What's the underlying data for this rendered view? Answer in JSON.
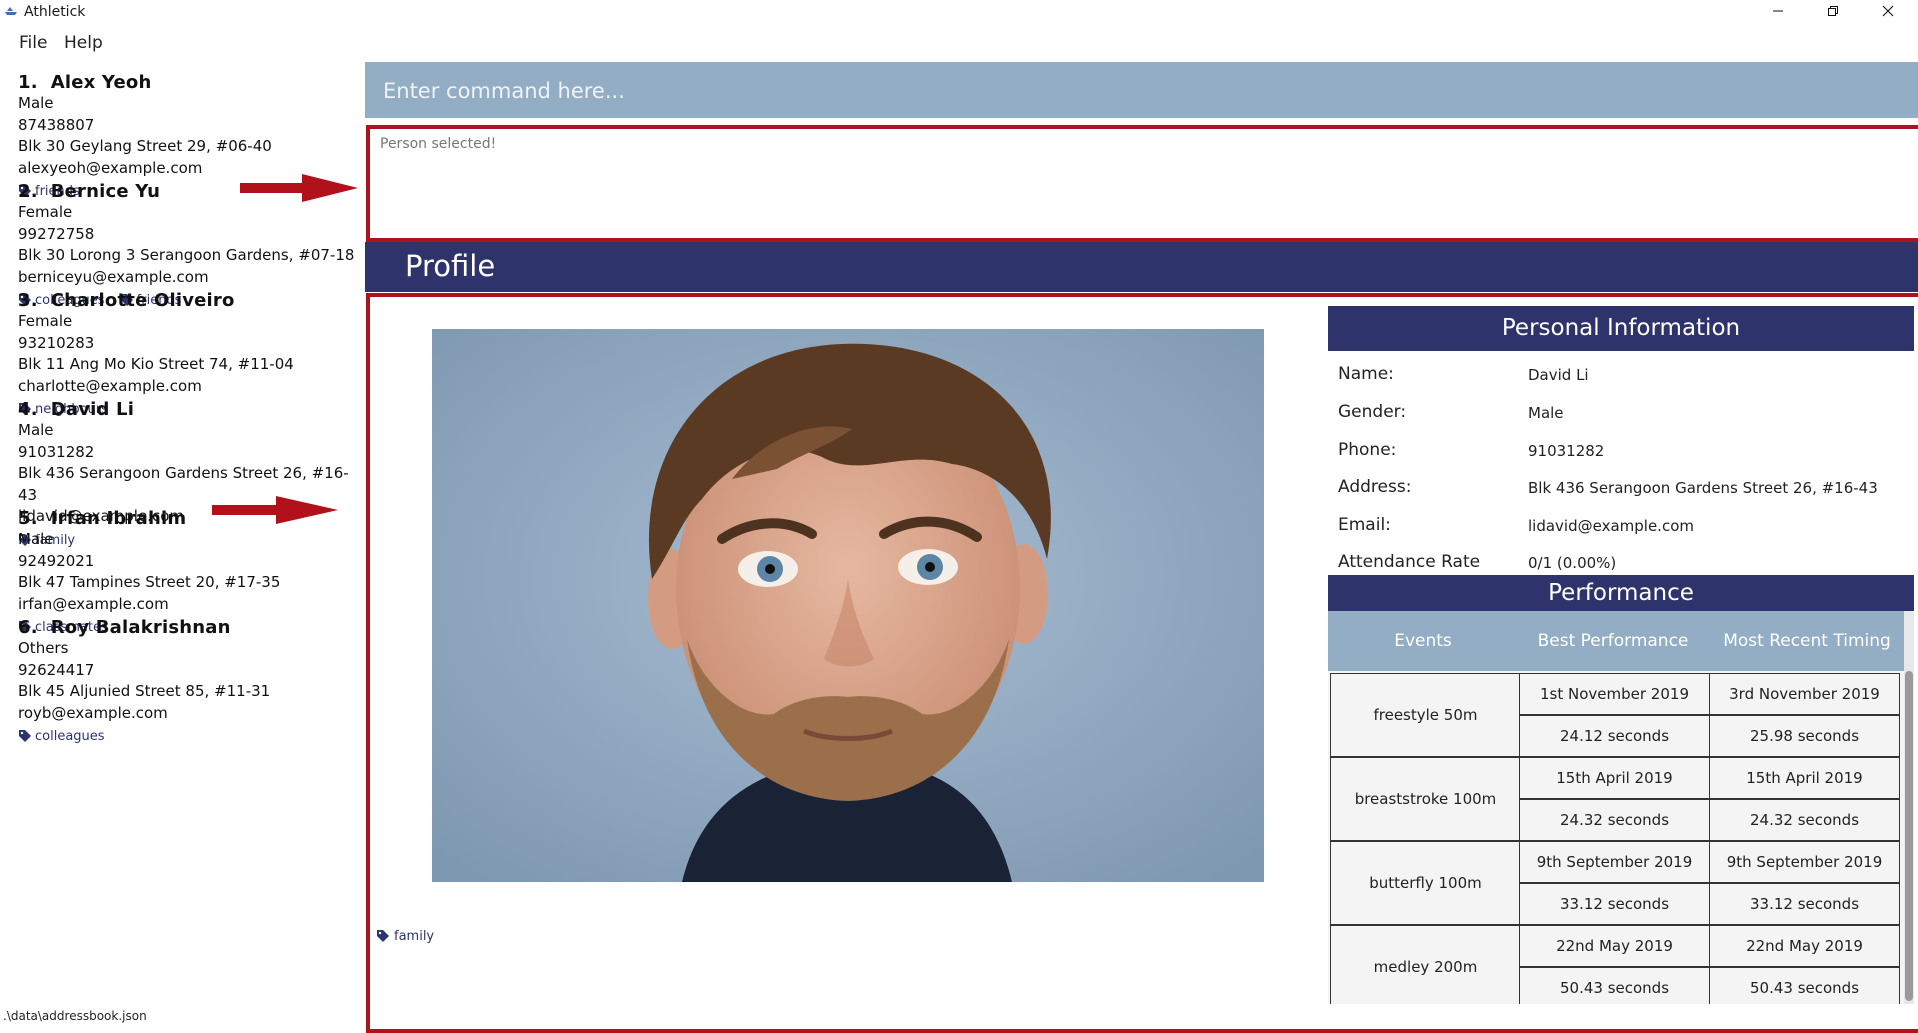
{
  "window": {
    "title": "Athletick",
    "minimize_icon": "minimize-icon",
    "restore_icon": "restore-icon",
    "close_icon": "close-icon"
  },
  "menu": {
    "file": "File",
    "help": "Help"
  },
  "persons": [
    {
      "index": "1.",
      "name": "Alex Yeoh",
      "gender": "Male",
      "phone": "87438807",
      "address": "Blk 30 Geylang Street 29, #06-40",
      "email": "alexyeoh@example.com",
      "tags": [
        "friends"
      ]
    },
    {
      "index": "2.",
      "name": "Bernice Yu",
      "gender": "Female",
      "phone": "99272758",
      "address": "Blk 30 Lorong 3 Serangoon Gardens, #07-18",
      "email": "berniceyu@example.com",
      "tags": [
        "colleagues",
        "friends"
      ]
    },
    {
      "index": "3.",
      "name": "Charlotte Oliveiro",
      "gender": "Female",
      "phone": "93210283",
      "address": "Blk 11 Ang Mo Kio Street 74, #11-04",
      "email": "charlotte@example.com",
      "tags": [
        "neighbours"
      ]
    },
    {
      "index": "4.",
      "name": "David Li",
      "gender": "Male",
      "phone": "91031282",
      "address": "Blk 436 Serangoon Gardens Street 26, #16-43",
      "email": "lidavid@example.com",
      "tags": [
        "family"
      ]
    },
    {
      "index": "5.",
      "name": "Irfan Ibrahim",
      "gender": "Male",
      "phone": "92492021",
      "address": "Blk 47 Tampines Street 20, #17-35",
      "email": "irfan@example.com",
      "tags": [
        "classmates"
      ]
    },
    {
      "index": "6.",
      "name": "Roy Balakrishnan",
      "gender": "Others",
      "phone": "92624417",
      "address": "Blk 45 Aljunied Street 85, #11-31",
      "email": "royb@example.com",
      "tags": [
        "colleagues"
      ]
    }
  ],
  "status_bar": {
    "path": ".\\data\\addressbook.json"
  },
  "command": {
    "placeholder": "Enter command here...",
    "value": ""
  },
  "result": {
    "text": "Person selected!"
  },
  "profile": {
    "header": "Profile",
    "tag": "family",
    "personal_info": {
      "title": "Personal Information",
      "rows": [
        {
          "label": "Name:",
          "value": "David Li"
        },
        {
          "label": "Gender:",
          "value": "Male"
        },
        {
          "label": "Phone:",
          "value": "91031282"
        },
        {
          "label": "Address:",
          "value": "Blk 436 Serangoon Gardens Street 26, #16-43"
        },
        {
          "label": "Email:",
          "value": "lidavid@example.com"
        },
        {
          "label": "Attendance Rate",
          "value": "0/1 (0.00%)"
        }
      ]
    },
    "performance": {
      "title": "Performance",
      "columns": [
        "Events",
        "Best Performance",
        "Most Recent Timing"
      ],
      "events": [
        {
          "name": "freestyle 50m",
          "best_date": "1st November 2019",
          "best_time": "24.12 seconds",
          "recent_date": "3rd November 2019",
          "recent_time": "25.98 seconds"
        },
        {
          "name": "breaststroke 100m",
          "best_date": "15th April 2019",
          "best_time": "24.32 seconds",
          "recent_date": "15th April 2019",
          "recent_time": "24.32 seconds"
        },
        {
          "name": "butterfly 100m",
          "best_date": "9th September 2019",
          "best_time": "33.12 seconds",
          "recent_date": "9th September 2019",
          "recent_time": "33.12 seconds"
        },
        {
          "name": "medley 200m",
          "best_date": "22nd May 2019",
          "best_time": "50.43 seconds",
          "recent_date": "22nd May 2019",
          "recent_time": "50.43 seconds"
        }
      ]
    }
  },
  "colors": {
    "accent": "#2f336b",
    "command_bg": "#93aec4",
    "highlight": "#b0111b",
    "tag": "#2b3470"
  }
}
